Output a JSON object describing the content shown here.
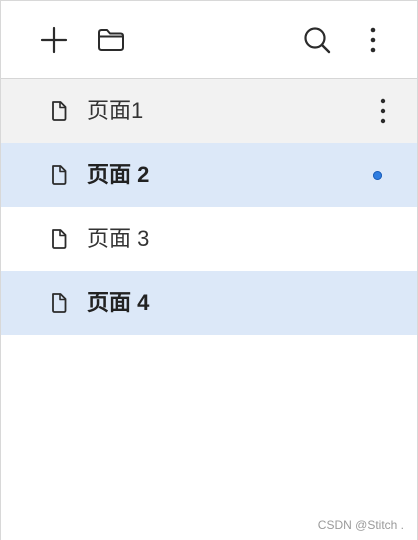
{
  "toolbar": {
    "add_icon": "plus-icon",
    "folder_icon": "folder-icon",
    "search_icon": "search-icon",
    "more_icon": "vertical-ellipsis-icon"
  },
  "pages": [
    {
      "label": "页面1",
      "state": "hover",
      "show_more": true,
      "unsaved": false
    },
    {
      "label": "页面 2",
      "state": "selected",
      "show_more": false,
      "unsaved": true
    },
    {
      "label": "页面 3",
      "state": "normal",
      "show_more": false,
      "unsaved": false
    },
    {
      "label": "页面 4",
      "state": "selected",
      "show_more": false,
      "unsaved": false
    }
  ],
  "colors": {
    "hover_bg": "#f2f2f2",
    "selected_bg": "#dce8f8",
    "unsaved_dot": "#2f7de1"
  },
  "watermark": "CSDN @Stitch ."
}
